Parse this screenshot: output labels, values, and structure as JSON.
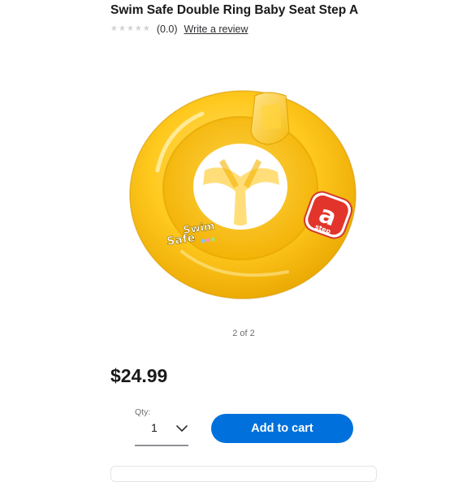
{
  "product": {
    "title": "Swim Safe Double Ring Baby Seat Step A",
    "rating": {
      "stars_filled": 0,
      "stars_total": 5,
      "count_label": "(0.0)",
      "review_link": "Write a review"
    },
    "image": {
      "description_icon": "inflatable-baby-seat-image",
      "brand_logo_line1": "Swim",
      "brand_logo_line2": "Safe",
      "step_badge_line1": "step",
      "step_badge_letter": "a",
      "main_color": "#ffc20e"
    },
    "pager": "2 of 2",
    "price": "$24.99"
  },
  "purchase": {
    "qty_label": "Qty:",
    "qty_value": "1",
    "add_to_cart": "Add to cart",
    "button_color": "#0071dc"
  }
}
